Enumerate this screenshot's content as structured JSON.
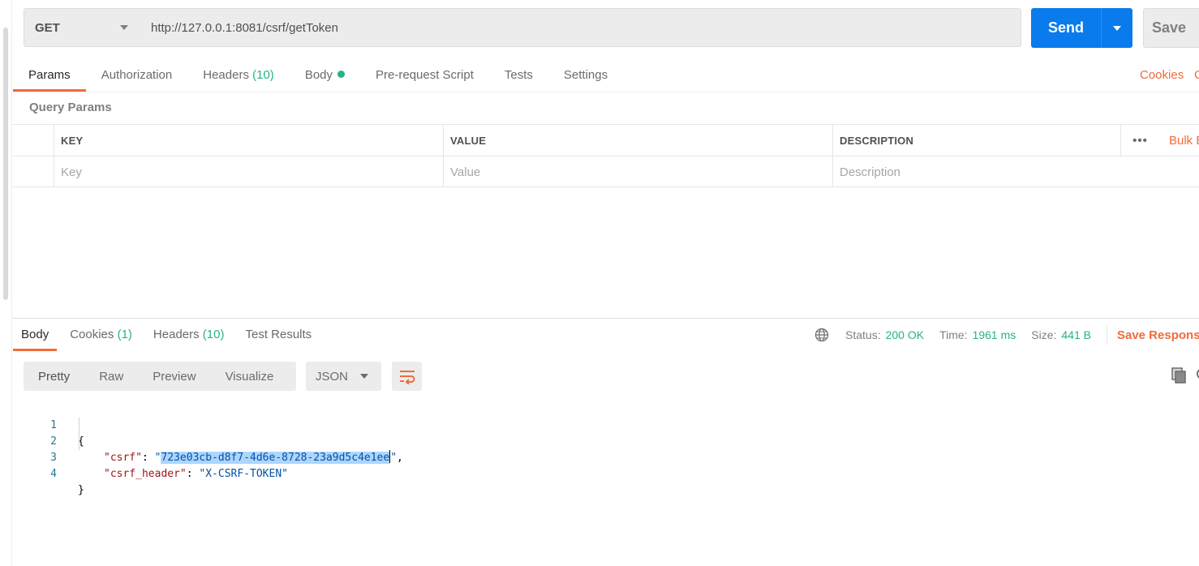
{
  "request": {
    "method": "GET",
    "url": "http://127.0.0.1:8081/csrf/getToken",
    "send_label": "Send",
    "save_label": "Save"
  },
  "request_tabs": [
    {
      "label": "Params",
      "active": true
    },
    {
      "label": "Authorization"
    },
    {
      "label": "Headers",
      "count": "(10)"
    },
    {
      "label": "Body",
      "has_dot": true
    },
    {
      "label": "Pre-request Script"
    },
    {
      "label": "Tests"
    },
    {
      "label": "Settings"
    }
  ],
  "right_links": {
    "cookies": "Cookies",
    "code": "C"
  },
  "query_params": {
    "title": "Query Params",
    "columns": [
      "KEY",
      "VALUE",
      "DESCRIPTION"
    ],
    "placeholders": [
      "Key",
      "Value",
      "Description"
    ],
    "more_label": "•••",
    "bulk_edit": "Bulk E"
  },
  "response_tabs": [
    {
      "label": "Body",
      "active": true
    },
    {
      "label": "Cookies",
      "count": "(1)"
    },
    {
      "label": "Headers",
      "count": "(10)"
    },
    {
      "label": "Test Results"
    }
  ],
  "status": {
    "status_key": "Status:",
    "status_value": "200 OK",
    "time_key": "Time:",
    "time_value": "1961 ms",
    "size_key": "Size:",
    "size_value": "441 B",
    "save_response": "Save Response"
  },
  "format_tabs": [
    "Pretty",
    "Raw",
    "Preview",
    "Visualize"
  ],
  "format_selected": "JSON",
  "body_lines": {
    "l1": "{",
    "l2_key": "\"csrf\"",
    "l2_colon": ": ",
    "l2_value": "723e03cb-d8f7-4d6e-8728-23a9d5c4e1ee",
    "l2_end": ",",
    "l3_key": "\"csrf_header\"",
    "l3_colon": ": ",
    "l3_value": "\"X-CSRF-TOKEN\"",
    "l4": "}",
    "quote": "\"",
    "numbers": [
      "1",
      "2",
      "3",
      "4"
    ]
  },
  "colors": {
    "accent": "#f26b3a",
    "primary": "#097bed",
    "success": "#26b47f"
  },
  "icons": {
    "method_dropdown": "chevron-down-icon",
    "send_dropdown": "chevron-down-icon",
    "globe": "globe-icon",
    "wrap": "wrap-lines-icon",
    "copy": "copy-icon",
    "search": "search-icon"
  }
}
